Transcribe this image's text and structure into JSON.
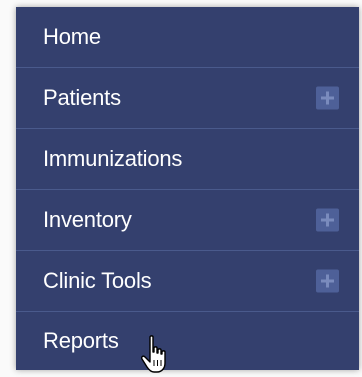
{
  "menu": {
    "items": [
      {
        "label": "Home",
        "expandable": false
      },
      {
        "label": "Patients",
        "expandable": true
      },
      {
        "label": "Immunizations",
        "expandable": false
      },
      {
        "label": "Inventory",
        "expandable": true
      },
      {
        "label": "Clinic Tools",
        "expandable": true
      },
      {
        "label": "Reports",
        "expandable": false
      }
    ]
  },
  "colors": {
    "menu_background": "#34406e",
    "divider": "#4a5a8c",
    "expand_button": "#4e6098",
    "text": "#ffffff"
  },
  "icons": {
    "expand": "plus-icon",
    "cursor": "hand-pointer-icon"
  }
}
